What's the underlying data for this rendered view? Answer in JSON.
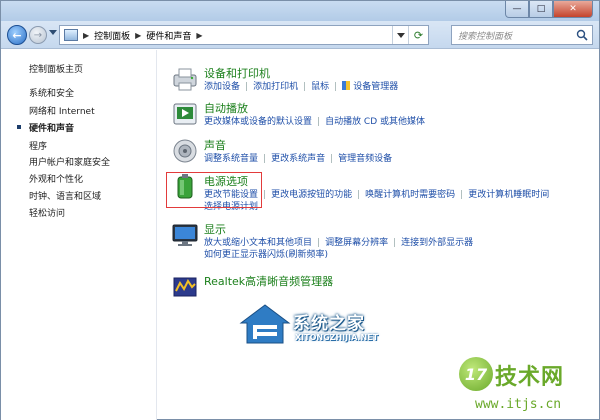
{
  "titlebar": {
    "minimize_glyph": "—",
    "maximize_glyph": "□",
    "close_glyph": "✕"
  },
  "nav": {
    "back_glyph": "←",
    "forward_glyph": "→",
    "breadcrumb": [
      "控制面板",
      "硬件和声音"
    ],
    "crumb_sep": "▶",
    "refresh_glyph": "⟳",
    "search_placeholder": "搜索控制面板"
  },
  "sidebar": {
    "items": [
      {
        "label": "控制面板主页"
      },
      {
        "label": "系统和安全"
      },
      {
        "label": "网络和 Internet"
      },
      {
        "label": "硬件和声音",
        "current": true
      },
      {
        "label": "程序"
      },
      {
        "label": "用户帐户和家庭安全"
      },
      {
        "label": "外观和个性化"
      },
      {
        "label": "时钟、语言和区域"
      },
      {
        "label": "轻松访问"
      }
    ]
  },
  "categories": {
    "devices": {
      "title": "设备和打印机",
      "links": [
        "添加设备",
        "添加打印机",
        "鼠标",
        "设备管理器"
      ]
    },
    "autoplay": {
      "title": "自动播放",
      "links": [
        "更改媒体或设备的默认设置",
        "自动播放 CD 或其他媒体"
      ]
    },
    "sound": {
      "title": "声音",
      "links": [
        "调整系统音量",
        "更改系统声音",
        "管理音频设备"
      ]
    },
    "power": {
      "title": "电源选项",
      "links": [
        "更改节能设置",
        "更改电源按钮的功能",
        "唤醒计算机时需要密码",
        "更改计算机睡眠时间"
      ],
      "links2": [
        "选择电源计划"
      ]
    },
    "display": {
      "title": "显示",
      "links": [
        "放大或缩小文本和其他项目",
        "调整屏幕分辨率",
        "连接到外部显示器"
      ],
      "links2": [
        "如何更正显示器闪烁(刷新频率)"
      ]
    },
    "realtek": {
      "title": "Realtek高清晰音频管理器"
    }
  },
  "watermarks": {
    "xitongzhijia_cn": "系统之家",
    "xitongzhijia_en": "XITONGZHIJIA.NET",
    "itjs_badge": "17",
    "itjs_name": "技术网",
    "itjs_url": "www.itjs.cn"
  },
  "colors": {
    "link": "#1f4fa8",
    "category_title": "#1a7f1a",
    "highlight_box": "#e23b3b"
  }
}
